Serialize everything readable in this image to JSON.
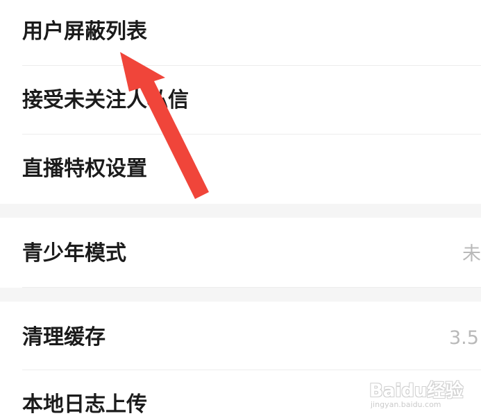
{
  "settings": {
    "items": [
      {
        "label": "用户屏蔽列表",
        "value": ""
      },
      {
        "label": "接受未关注人私信",
        "value": ""
      },
      {
        "label": "直播特权设置",
        "value": ""
      },
      {
        "label": "青少年模式",
        "value": "未"
      },
      {
        "label": "清理缓存",
        "value": "3.5"
      },
      {
        "label": "本地日志上传",
        "value": ""
      }
    ]
  },
  "annotation": {
    "arrow_color": "#f0453a",
    "points_to": "用户屏蔽列表"
  },
  "watermark": {
    "logo_text": "Baidu经验",
    "url_text": "jingyan.baidu.com"
  }
}
